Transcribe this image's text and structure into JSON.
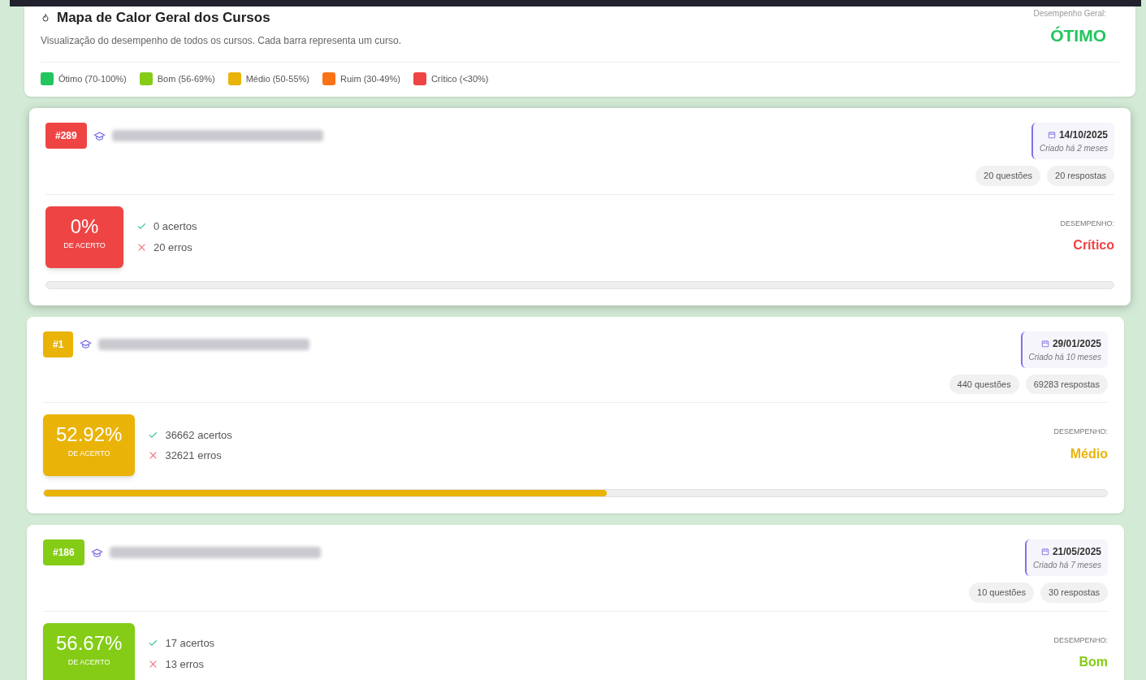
{
  "heatmap": {
    "title": "Mapa de Calor Geral dos Cursos",
    "subtitle": "Visualização do desempenho de todos os cursos. Cada barra representa um curso.",
    "overall_label": "Desempenho Geral:",
    "overall_value": "ÓTIMO",
    "legend": [
      {
        "label": "Ótimo (70-100%)",
        "color": "#22c55e"
      },
      {
        "label": "Bom (56-69%)",
        "color": "#84cc16"
      },
      {
        "label": "Médio (50-55%)",
        "color": "#eab308"
      },
      {
        "label": "Ruim (30-49%)",
        "color": "#f97316"
      },
      {
        "label": "Crítico (<30%)",
        "color": "#ef4444"
      }
    ]
  },
  "courses": [
    {
      "id": "#289",
      "color": "#ef4444",
      "date": "14/10/2025",
      "created": "Criado há 2 meses",
      "questions": "20 questões",
      "answers": "20 respostas",
      "percent": "0%",
      "percent_caption": "DE ACERTO",
      "correct": "0 acertos",
      "wrong": "20 erros",
      "performance_label": "DESEMPENHO:",
      "performance": "Crítico",
      "level": 0,
      "raised": true
    },
    {
      "id": "#1",
      "color": "#eab308",
      "date": "29/01/2025",
      "created": "Criado há 10 meses",
      "questions": "440 questões",
      "answers": "69283 respostas",
      "percent": "52.92%",
      "percent_caption": "DE ACERTO",
      "correct": "36662 acertos",
      "wrong": "32621 erros",
      "performance_label": "DESEMPENHO:",
      "performance": "Médio",
      "level": 0.5292,
      "raised": false
    },
    {
      "id": "#186",
      "color": "#84cc16",
      "date": "21/05/2025",
      "created": "Criado há 7 meses",
      "questions": "10 questões",
      "answers": "30 respostas",
      "percent": "56.67%",
      "percent_caption": "DE ACERTO",
      "correct": "17 acertos",
      "wrong": "13 erros",
      "performance_label": "DESEMPENHO:",
      "performance": "Bom",
      "raised": false
    }
  ]
}
